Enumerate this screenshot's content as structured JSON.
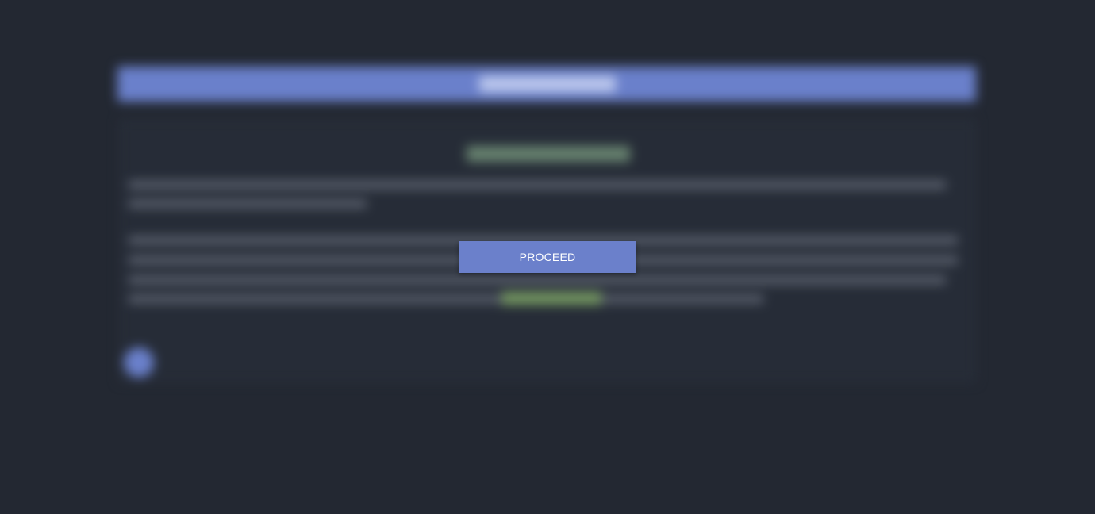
{
  "overlay": {
    "proceed_label": "PROCEED"
  },
  "colors": {
    "background": "#232832",
    "accent": "#6b80cb",
    "success_text": "#7fa864"
  }
}
